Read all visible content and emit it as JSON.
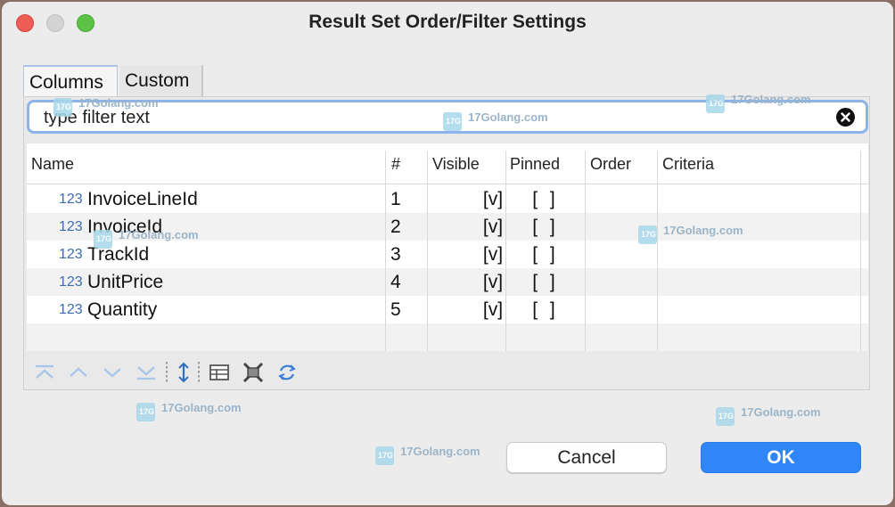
{
  "window": {
    "title": "Result Set Order/Filter Settings"
  },
  "tabs": [
    {
      "label": "Columns"
    },
    {
      "label": "Custom"
    }
  ],
  "filter": {
    "placeholder": "type filter text"
  },
  "grid": {
    "headers": [
      "Name",
      "#",
      "Visible",
      "Pinned",
      "Order",
      "Criteria"
    ],
    "type_icon": "123",
    "rows": [
      {
        "name": "InvoiceLineId",
        "num": "1",
        "visible": "[v]",
        "pinned": "[ ]",
        "order": "",
        "criteria": ""
      },
      {
        "name": "InvoiceId",
        "num": "2",
        "visible": "[v]",
        "pinned": "[ ]",
        "order": "",
        "criteria": ""
      },
      {
        "name": "TrackId",
        "num": "3",
        "visible": "[v]",
        "pinned": "[ ]",
        "order": "",
        "criteria": ""
      },
      {
        "name": "UnitPrice",
        "num": "4",
        "visible": "[v]",
        "pinned": "[ ]",
        "order": "",
        "criteria": ""
      },
      {
        "name": "Quantity",
        "num": "5",
        "visible": "[v]",
        "pinned": "[ ]",
        "order": "",
        "criteria": ""
      }
    ]
  },
  "toolbar": {
    "icons": [
      "move-top-icon",
      "move-up-icon",
      "move-down-icon",
      "move-bottom-icon",
      "sort-icon",
      "table-icon",
      "clear-filter-icon",
      "refresh-icon"
    ]
  },
  "buttons": {
    "cancel": "Cancel",
    "ok": "OK"
  },
  "watermark": {
    "text": "17Golang.com",
    "logo": "17G"
  },
  "colors": {
    "accent": "#2f86f6",
    "focus_ring": "#8eb3ea",
    "icon_blue": "#3b6db0"
  }
}
